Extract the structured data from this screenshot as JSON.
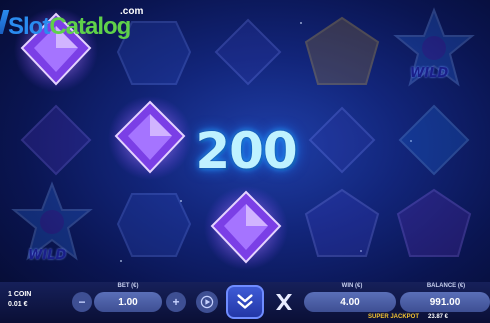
{
  "watermark": {
    "slot": "Slot",
    "catalog": "Catalog",
    "com": ".com"
  },
  "win": {
    "amount": "200"
  },
  "reels": {
    "wild_label": "WILD"
  },
  "bottom_bar": {
    "coin_line1": "1 COIN",
    "coin_line2": "0.01 €",
    "bet_label": "BET (€)",
    "bet_value": "1.00",
    "bet_minus": "−",
    "bet_plus": "+",
    "win_label": "WIN (€)",
    "win_value": "4.00",
    "balance_label": "BALANCE (€)",
    "balance_value": "991.00",
    "jackpot_label": "SUPER JACKPOT",
    "jackpot_value": "23.87 €"
  },
  "colors": {
    "purple_gem": "#9b5cff",
    "blue_gem": "#3a8cff",
    "gold": "#f2c230",
    "background": "#12257a"
  },
  "icons": [
    "autoplay-icon",
    "spin-icon",
    "turbo-icon"
  ]
}
